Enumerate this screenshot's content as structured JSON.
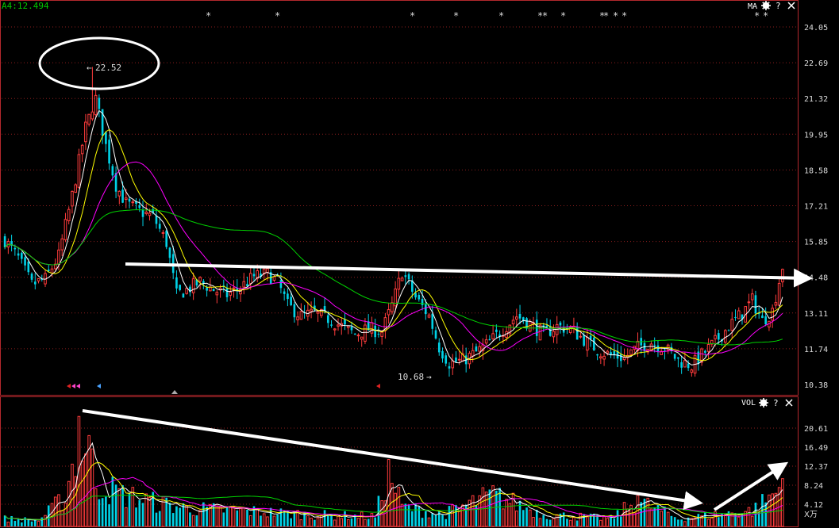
{
  "colors": {
    "background": "#000000",
    "up": "#ff3c3c",
    "down": "#00d2e6",
    "frame": "#b4282d",
    "grid": "#8c1e1e",
    "axis_text": "#dcdcdc",
    "ma5": "#ffffff",
    "ma10": "#ffff00",
    "ma20": "#ff00ff",
    "ma60": "#00d200",
    "header_green": "#00c800"
  },
  "header": {
    "ma_readout": "A4:12.494",
    "price_label": "MA",
    "volume_label": "VOL",
    "settings_icon": "gear-icon",
    "help_icon": "help-icon",
    "close_icon": "close-icon"
  },
  "price_axis": {
    "ticks": [
      "24.05",
      "22.69",
      "21.32",
      "19.95",
      "18.58",
      "17.21",
      "15.85",
      "14.48",
      "13.11",
      "11.74",
      "10.38"
    ]
  },
  "volume_axis": {
    "ticks": [
      "20.61",
      "16.49",
      "12.37",
      "8.24",
      "4.12"
    ],
    "unit": "X万"
  },
  "annotations": {
    "high_label": "22.52",
    "low_label": "10.68"
  },
  "chart_data": [
    {
      "type": "candlestick",
      "ylim": [
        10.38,
        24.05
      ],
      "high": 22.52,
      "low": 10.68,
      "last_ma": 12.494,
      "close_path": [
        [
          0,
          15.9
        ],
        [
          4,
          15.2
        ],
        [
          8,
          14.2
        ],
        [
          12,
          14.4
        ],
        [
          16,
          15.3
        ],
        [
          20,
          17.6
        ],
        [
          24,
          20.2
        ],
        [
          27,
          21.3
        ],
        [
          30,
          19.5
        ],
        [
          33,
          18.0
        ],
        [
          36,
          17.3
        ],
        [
          40,
          17.0
        ],
        [
          44,
          16.8
        ],
        [
          48,
          15.8
        ],
        [
          51,
          13.8
        ],
        [
          54,
          14.0
        ],
        [
          58,
          14.3
        ],
        [
          62,
          14.0
        ],
        [
          66,
          13.8
        ],
        [
          70,
          14.1
        ],
        [
          74,
          14.5
        ],
        [
          78,
          14.6
        ],
        [
          81,
          14.3
        ],
        [
          84,
          13.4
        ],
        [
          88,
          13.0
        ],
        [
          92,
          13.1
        ],
        [
          96,
          12.9
        ],
        [
          100,
          12.6
        ],
        [
          104,
          12.3
        ],
        [
          108,
          12.5
        ],
        [
          112,
          12.4
        ],
        [
          115,
          13.4
        ],
        [
          118,
          14.7
        ],
        [
          122,
          13.7
        ],
        [
          126,
          13.0
        ],
        [
          129,
          11.8
        ],
        [
          132,
          11.2
        ],
        [
          136,
          11.3
        ],
        [
          140,
          11.6
        ],
        [
          144,
          12.0
        ],
        [
          148,
          12.5
        ],
        [
          152,
          13.0
        ],
        [
          156,
          12.7
        ],
        [
          160,
          12.3
        ],
        [
          164,
          12.6
        ],
        [
          168,
          12.5
        ],
        [
          172,
          12.1
        ],
        [
          176,
          11.7
        ],
        [
          180,
          11.5
        ],
        [
          184,
          11.4
        ],
        [
          188,
          11.8
        ],
        [
          192,
          12.0
        ],
        [
          196,
          11.8
        ],
        [
          200,
          11.3
        ],
        [
          204,
          11.1
        ],
        [
          207,
          11.5
        ],
        [
          211,
          12.0
        ],
        [
          215,
          12.6
        ],
        [
          219,
          13.1
        ],
        [
          222,
          13.6
        ],
        [
          225,
          12.8
        ],
        [
          228,
          13.2
        ],
        [
          231,
          14.9
        ]
      ]
    },
    {
      "type": "bar",
      "unit": "X万",
      "ylim": [
        0,
        24.7
      ],
      "peaks": [
        [
          0,
          2.0
        ],
        [
          10,
          1.5
        ],
        [
          18,
          7.5
        ],
        [
          22,
          23.0
        ],
        [
          25,
          19.0
        ],
        [
          27,
          11.0
        ],
        [
          35,
          8.0
        ],
        [
          45,
          6.0
        ],
        [
          55,
          4.5
        ],
        [
          70,
          4.0
        ],
        [
          90,
          3.0
        ],
        [
          110,
          2.5
        ],
        [
          114,
          14.0
        ],
        [
          118,
          5.0
        ],
        [
          130,
          3.0
        ],
        [
          145,
          8.0
        ],
        [
          160,
          3.0
        ],
        [
          180,
          2.0
        ],
        [
          188,
          6.5
        ],
        [
          200,
          2.0
        ],
        [
          212,
          3.0
        ],
        [
          222,
          4.0
        ],
        [
          228,
          8.0
        ],
        [
          231,
          10.0
        ]
      ]
    }
  ]
}
